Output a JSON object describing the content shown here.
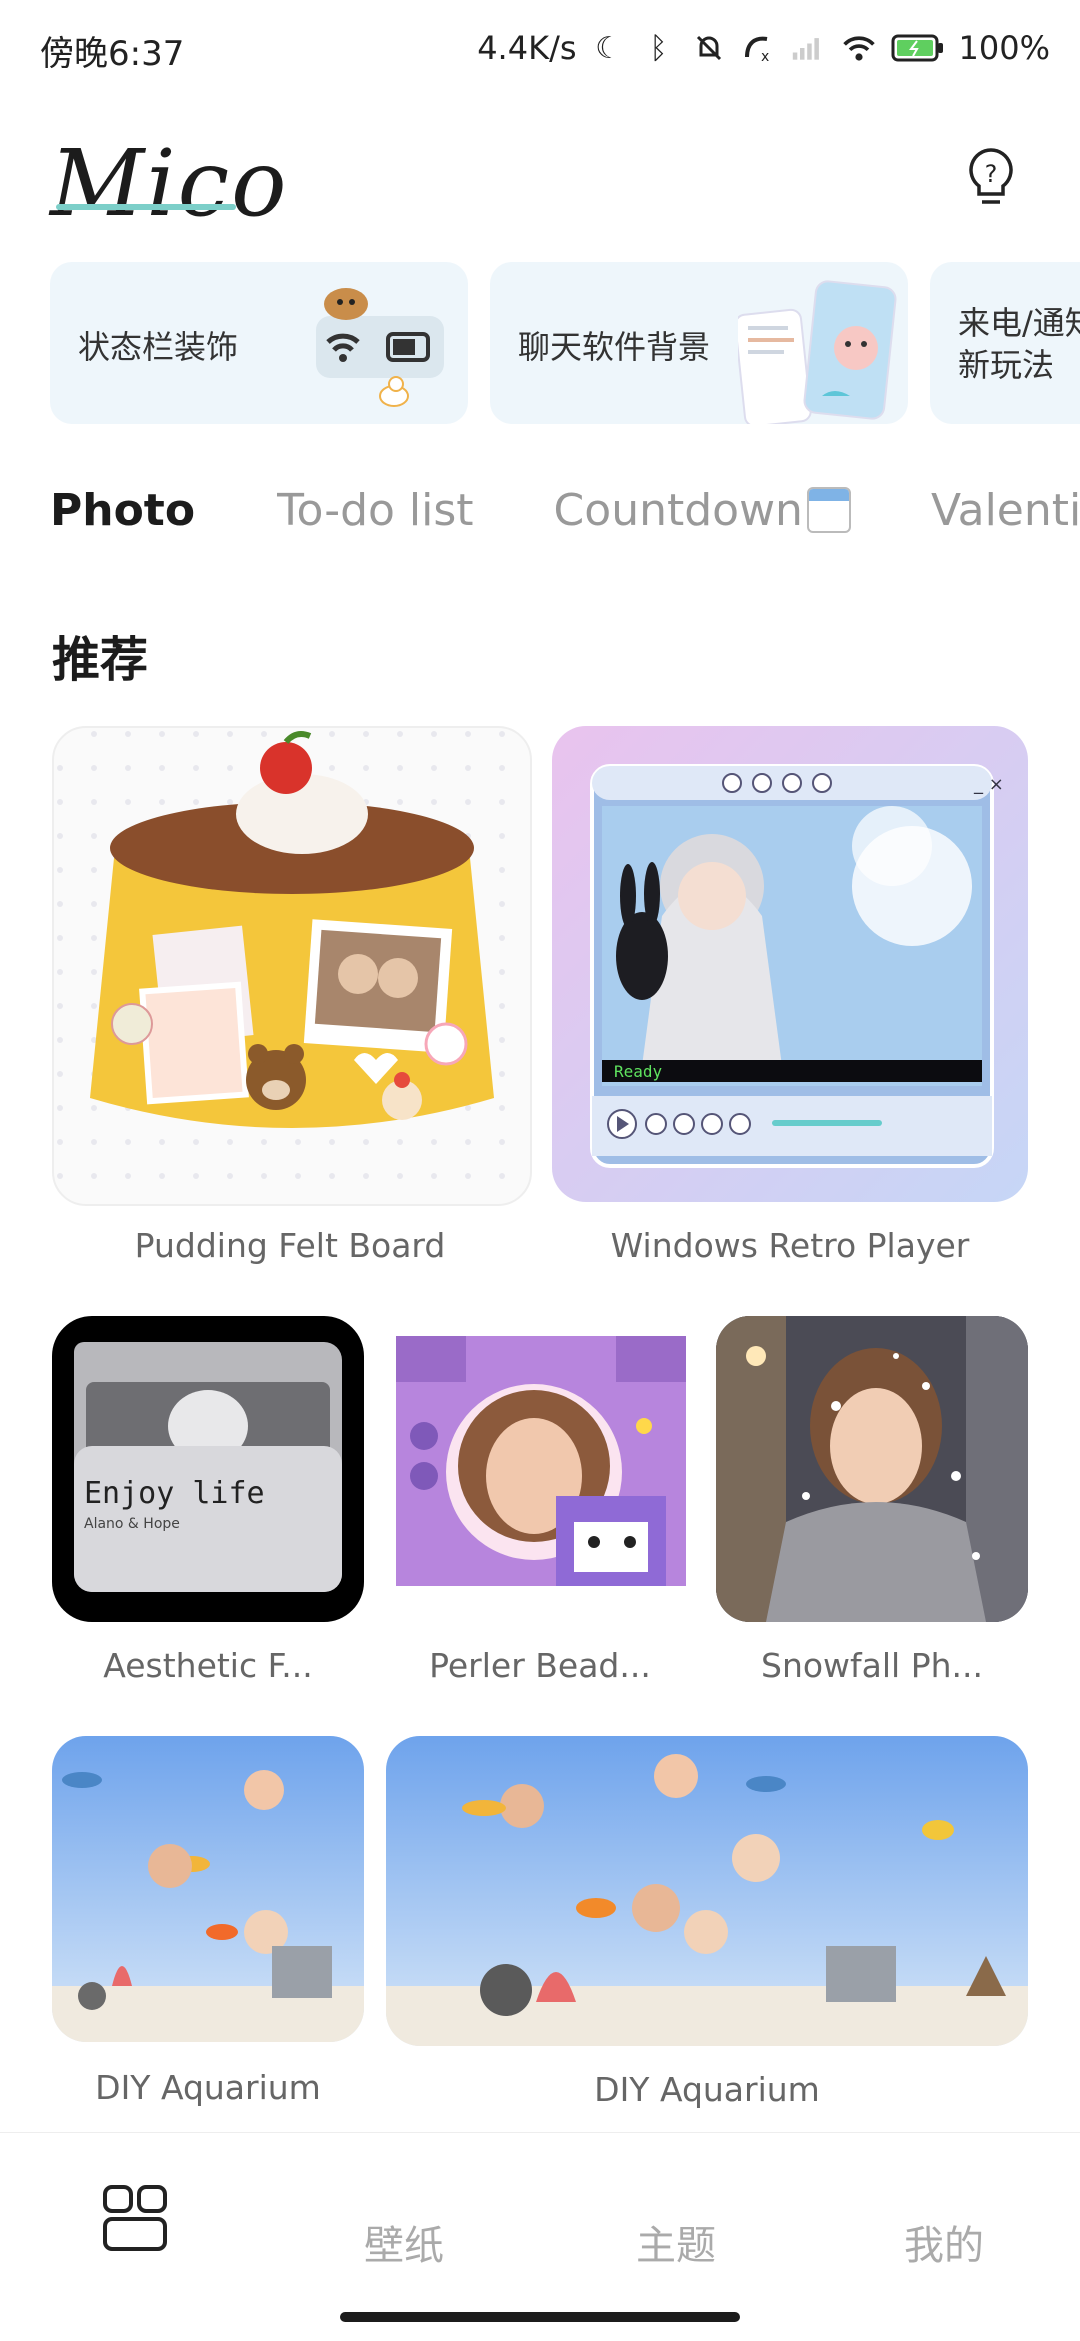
{
  "status_bar": {
    "time": "傍晚6:37",
    "net_speed": "4.4K/s",
    "battery": "100%"
  },
  "header": {
    "logo": "Mico",
    "help_icon": "question-bulb-icon"
  },
  "feature_cards": [
    {
      "label": "状态栏装饰"
    },
    {
      "label": "聊天软件背景"
    },
    {
      "label": "来电/通知\n新玩法"
    }
  ],
  "tabs": [
    {
      "label": "Photo",
      "active": true
    },
    {
      "label": "To-do list"
    },
    {
      "label": "Countdown"
    },
    {
      "label": "Valentine"
    }
  ],
  "section": {
    "title": "推荐"
  },
  "items": [
    {
      "caption": "Pudding Felt Board"
    },
    {
      "caption": "Windows Retro Player"
    },
    {
      "caption": "Aesthetic F..."
    },
    {
      "caption": "Perler Bead..."
    },
    {
      "caption": "Snowfall Ph..."
    },
    {
      "caption": "DIY Aquarium"
    },
    {
      "caption": "DIY Aquarium"
    }
  ],
  "retro_player": {
    "status": "Ready"
  },
  "aesthetic_folder": {
    "title": "Enjoy life",
    "subtitle": "Alano & Hope"
  },
  "bottom_nav": [
    {
      "label": "",
      "icon": "grid-icon"
    },
    {
      "label": "壁纸"
    },
    {
      "label": "主题"
    },
    {
      "label": "我的"
    }
  ]
}
